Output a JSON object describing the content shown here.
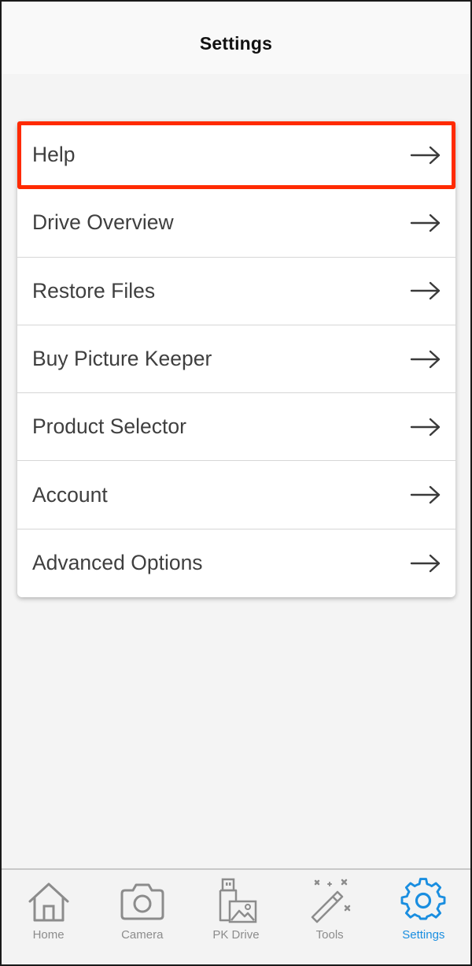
{
  "header": {
    "title": "Settings"
  },
  "menu": {
    "items": [
      {
        "label": "Help",
        "highlighted": true
      },
      {
        "label": "Drive Overview"
      },
      {
        "label": "Restore Files"
      },
      {
        "label": "Buy Picture Keeper"
      },
      {
        "label": "Product Selector"
      },
      {
        "label": "Account"
      },
      {
        "label": "Advanced Options"
      }
    ],
    "item_icon": "arrow-right-icon",
    "highlight_color": "#ff2a00"
  },
  "tabbar": {
    "tabs": [
      {
        "label": "Home",
        "icon": "home-icon"
      },
      {
        "label": "Camera",
        "icon": "camera-icon"
      },
      {
        "label": "PK Drive",
        "icon": "pk-drive-icon"
      },
      {
        "label": "Tools",
        "icon": "magic-wand-icon"
      },
      {
        "label": "Settings",
        "icon": "gear-icon",
        "active": true
      }
    ],
    "inactive_color": "#8c8c8c",
    "active_color": "#1a8ee0"
  }
}
